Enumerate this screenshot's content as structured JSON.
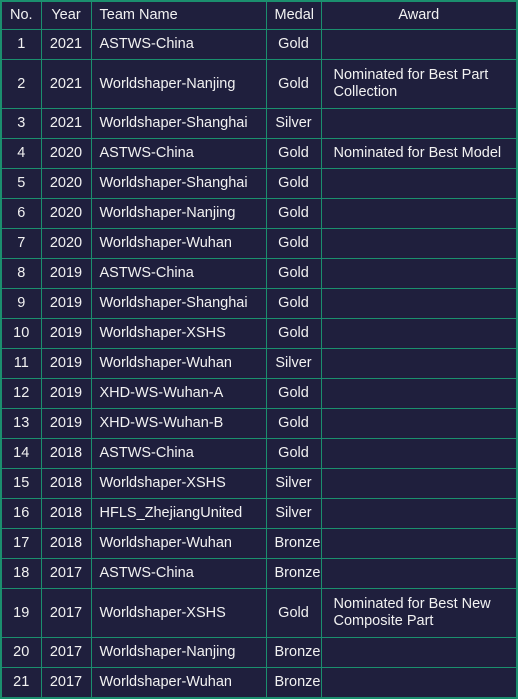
{
  "table": {
    "headers": [
      "No.",
      "Year",
      "Team Name",
      "Medal",
      "Award"
    ],
    "rows": [
      {
        "no": "1",
        "year": "2021",
        "team": "ASTWS-China",
        "medal": "Gold",
        "award": ""
      },
      {
        "no": "2",
        "year": "2021",
        "team": "Worldshaper-Nanjing",
        "medal": "Gold",
        "award": "Nominated for Best Part Collection"
      },
      {
        "no": "3",
        "year": "2021",
        "team": "Worldshaper-Shanghai",
        "medal": "Silver",
        "award": ""
      },
      {
        "no": "4",
        "year": "2020",
        "team": "ASTWS-China",
        "medal": "Gold",
        "award": "Nominated for Best Model"
      },
      {
        "no": "5",
        "year": "2020",
        "team": "Worldshaper-Shanghai",
        "medal": "Gold",
        "award": ""
      },
      {
        "no": "6",
        "year": "2020",
        "team": "Worldshaper-Nanjing",
        "medal": "Gold",
        "award": ""
      },
      {
        "no": "7",
        "year": "2020",
        "team": "Worldshaper-Wuhan",
        "medal": "Gold",
        "award": ""
      },
      {
        "no": "8",
        "year": "2019",
        "team": "ASTWS-China",
        "medal": "Gold",
        "award": ""
      },
      {
        "no": "9",
        "year": "2019",
        "team": "Worldshaper-Shanghai",
        "medal": "Gold",
        "award": ""
      },
      {
        "no": "10",
        "year": "2019",
        "team": "Worldshaper-XSHS",
        "medal": "Gold",
        "award": ""
      },
      {
        "no": "11",
        "year": "2019",
        "team": "Worldshaper-Wuhan",
        "medal": "Silver",
        "award": ""
      },
      {
        "no": "12",
        "year": "2019",
        "team": "XHD-WS-Wuhan-A",
        "medal": "Gold",
        "award": ""
      },
      {
        "no": "13",
        "year": "2019",
        "team": "XHD-WS-Wuhan-B",
        "medal": "Gold",
        "award": ""
      },
      {
        "no": "14",
        "year": "2018",
        "team": "ASTWS-China",
        "medal": "Gold",
        "award": ""
      },
      {
        "no": "15",
        "year": "2018",
        "team": "Worldshaper-XSHS",
        "medal": "Silver",
        "award": ""
      },
      {
        "no": "16",
        "year": "2018",
        "team": "HFLS_ZhejiangUnited",
        "medal": "Silver",
        "award": ""
      },
      {
        "no": "17",
        "year": "2018",
        "team": "Worldshaper-Wuhan",
        "medal": "Bronze",
        "award": ""
      },
      {
        "no": "18",
        "year": "2017",
        "team": "ASTWS-China",
        "medal": "Bronze",
        "award": ""
      },
      {
        "no": "19",
        "year": "2017",
        "team": "Worldshaper-XSHS",
        "medal": "Gold",
        "award": "Nominated for Best New Composite Part"
      },
      {
        "no": "20",
        "year": "2017",
        "team": "Worldshaper-Nanjing",
        "medal": "Bronze",
        "award": ""
      },
      {
        "no": "21",
        "year": "2017",
        "team": "Worldshaper-Wuhan",
        "medal": "Bronze",
        "award": ""
      }
    ]
  },
  "colors": {
    "background": "#1f1f3d",
    "border": "#1b8f6e",
    "text": "#f2f2f2"
  }
}
